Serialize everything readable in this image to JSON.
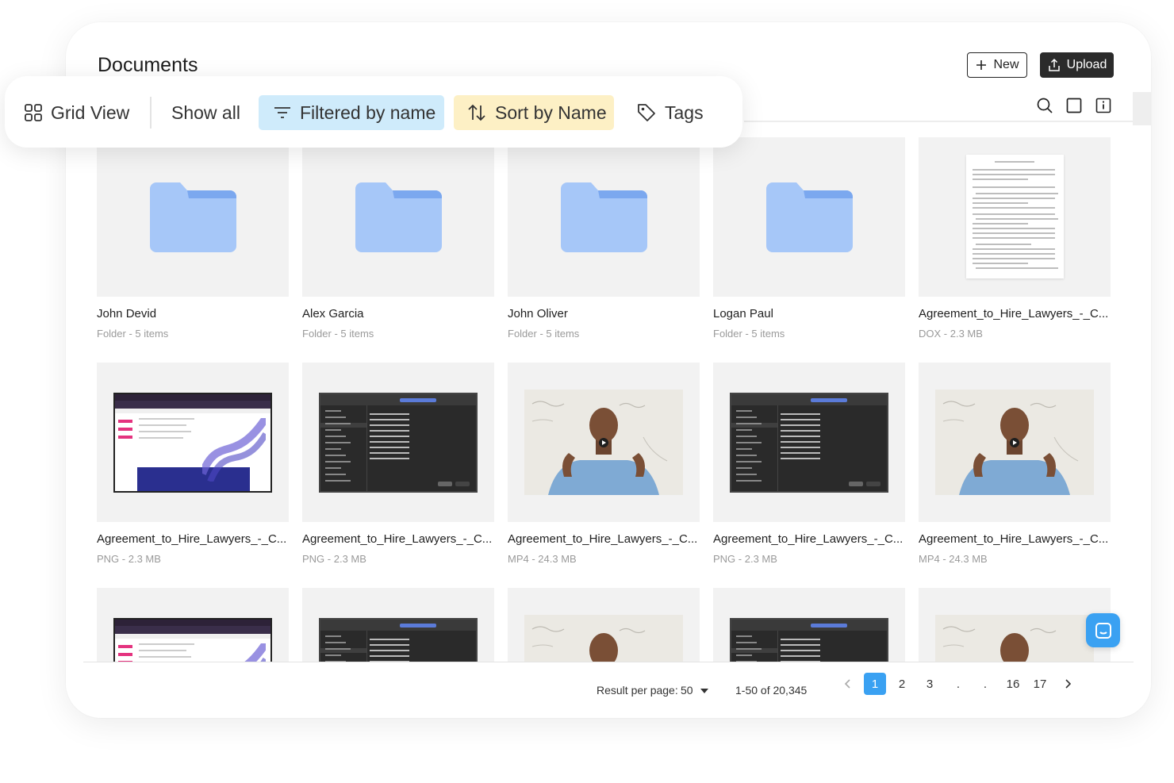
{
  "colors": {
    "accent": "#3aa1f2",
    "filter_bg": "#cfebfb",
    "sort_bg": "#fdf0c5",
    "folder": "#a6c7f8",
    "folder_tab": "#7ba8ef"
  },
  "page_title": "Documents",
  "header": {
    "new_label": "New",
    "upload_label": "Upload"
  },
  "tool_icons": [
    "search-icon",
    "square-icon",
    "info-icon"
  ],
  "toolbar": {
    "grid_view": "Grid View",
    "show_all": "Show all",
    "filtered_by": "Filtered by name",
    "sort_by": "Sort by Name",
    "tags": "Tags"
  },
  "files": [
    {
      "name": "John Devid",
      "meta": "Folder - 5 items",
      "type": "folder"
    },
    {
      "name": "Alex Garcia",
      "meta": "Folder - 5 items",
      "type": "folder"
    },
    {
      "name": "John Oliver",
      "meta": "Folder - 5 items",
      "type": "folder"
    },
    {
      "name": "Logan Paul",
      "meta": "Folder - 5 items",
      "type": "folder"
    },
    {
      "name": "Agreement_to_Hire_Lawyers_-_C...",
      "meta": "DOX - 2.3 MB",
      "type": "doc"
    },
    {
      "name": "Agreement_to_Hire_Lawyers_-_C...",
      "meta": "PNG - 2.3 MB",
      "type": "screenshot-light"
    },
    {
      "name": "Agreement_to_Hire_Lawyers_-_C...",
      "meta": "PNG - 2.3 MB",
      "type": "screenshot-dark"
    },
    {
      "name": "Agreement_to_Hire_Lawyers_-_C...",
      "meta": "MP4 - 24.3 MB",
      "type": "video"
    },
    {
      "name": "Agreement_to_Hire_Lawyers_-_C...",
      "meta": "PNG - 2.3 MB",
      "type": "screenshot-dark"
    },
    {
      "name": "Agreement_to_Hire_Lawyers_-_C...",
      "meta": "MP4 - 24.3 MB",
      "type": "video"
    },
    {
      "name": "",
      "meta": "",
      "type": "screenshot-light"
    },
    {
      "name": "",
      "meta": "",
      "type": "screenshot-dark"
    },
    {
      "name": "",
      "meta": "",
      "type": "video"
    },
    {
      "name": "",
      "meta": "",
      "type": "screenshot-dark"
    },
    {
      "name": "",
      "meta": "",
      "type": "video"
    }
  ],
  "pagination": {
    "per_page_label": "Result per page:",
    "per_page_value": "50",
    "range": "1-50 of 20,345",
    "pages": [
      "1",
      "2",
      "3",
      ".",
      ".",
      "16",
      "17"
    ],
    "current": "1"
  }
}
